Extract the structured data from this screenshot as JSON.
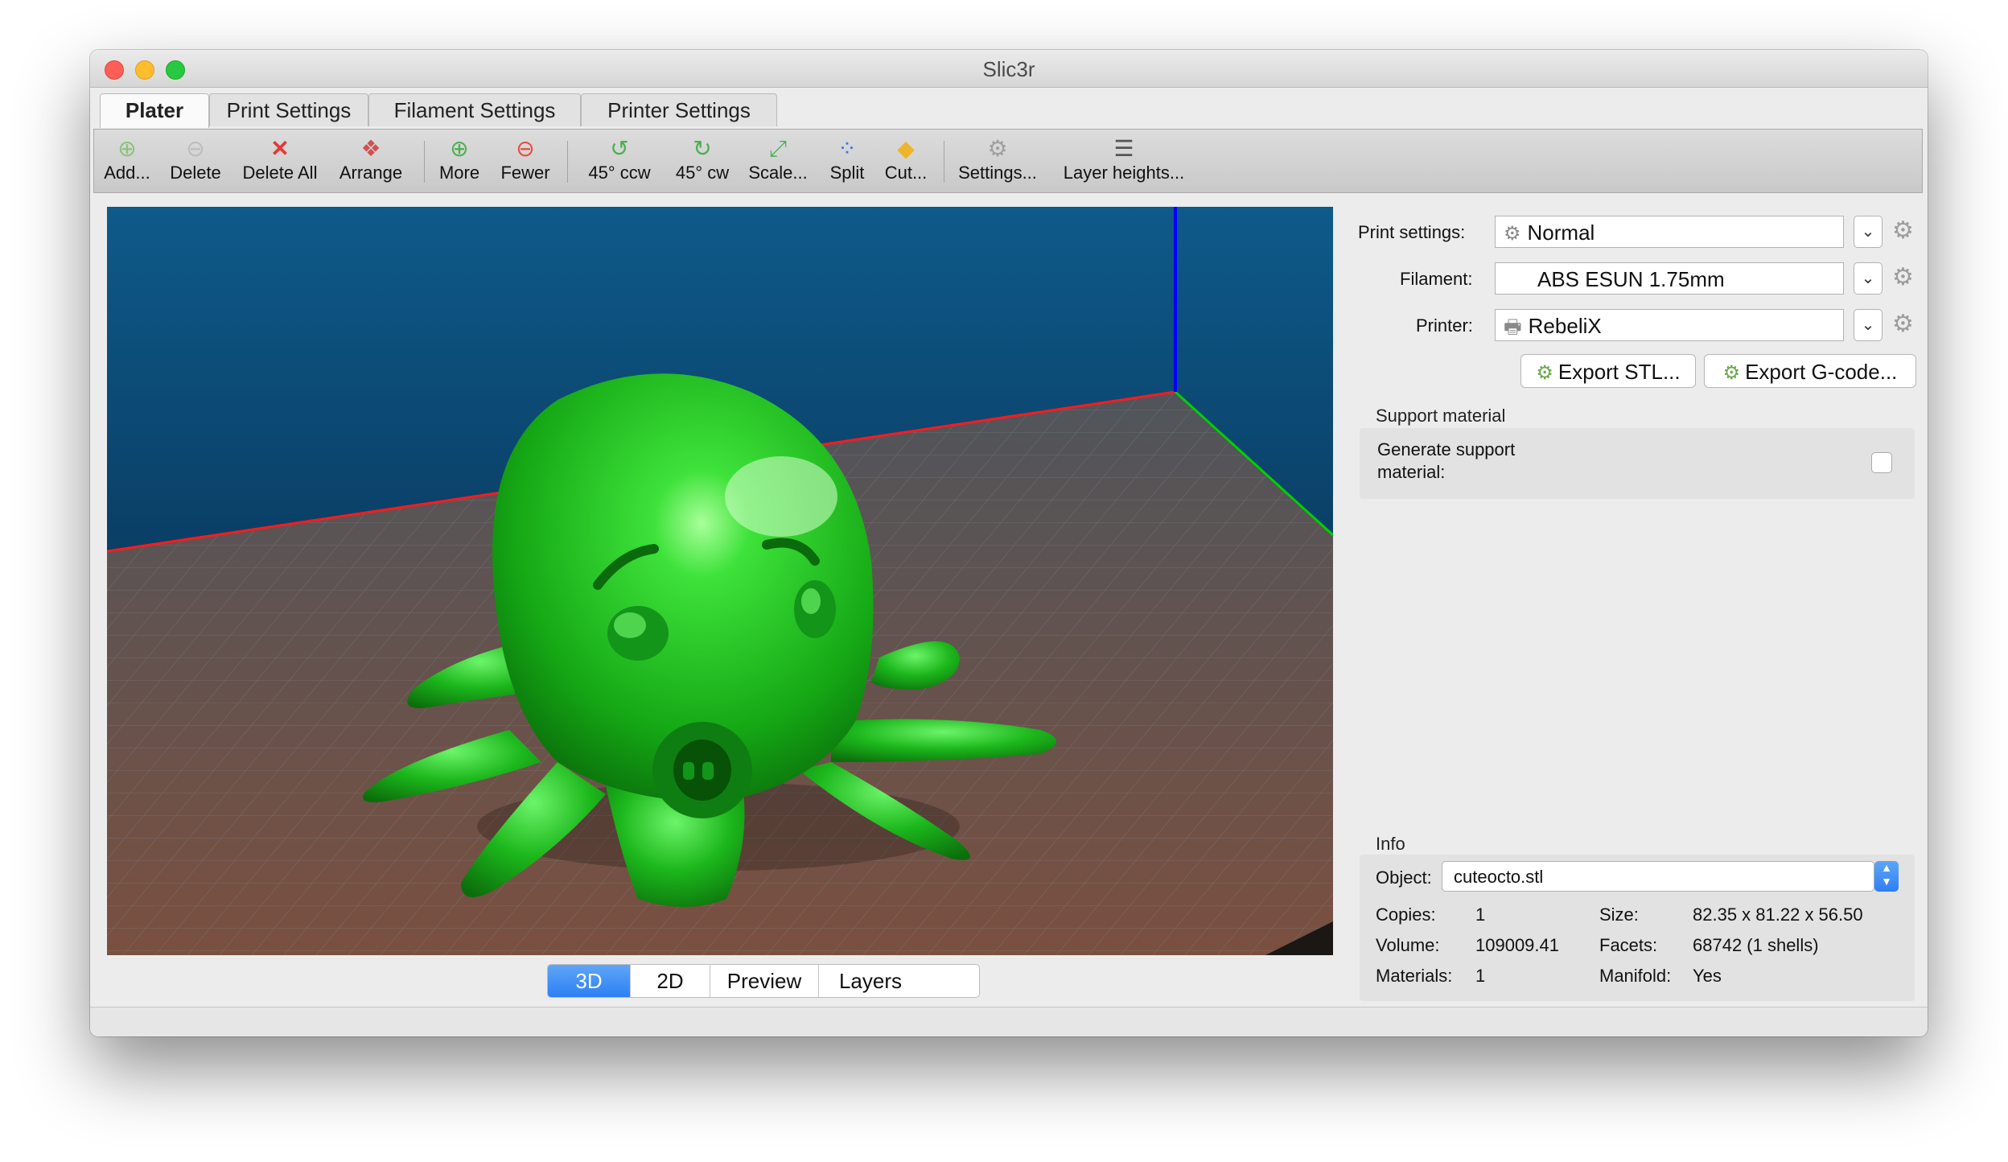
{
  "window": {
    "title": "Slic3r"
  },
  "tabs": [
    "Plater",
    "Print Settings",
    "Filament Settings",
    "Printer Settings"
  ],
  "toolbar": {
    "add": "Add...",
    "delete": "Delete",
    "delete_all": "Delete All",
    "arrange": "Arrange",
    "more": "More",
    "fewer": "Fewer",
    "rotate_ccw": "45° ccw",
    "rotate_cw": "45° cw",
    "scale": "Scale...",
    "split": "Split",
    "cut": "Cut...",
    "settings": "Settings...",
    "layer_heights": "Layer heights..."
  },
  "view_tabs": [
    "3D",
    "2D",
    "Preview",
    "Layers"
  ],
  "view_tabs_active": "3D",
  "presets": {
    "print_label": "Print settings:",
    "print_value": "Normal",
    "filament_label": "Filament:",
    "filament_value": "ABS ESUN 1.75mm",
    "printer_label": "Printer:",
    "printer_value": "RebeliX"
  },
  "export": {
    "stl": "Export STL...",
    "gcode": "Export G-code..."
  },
  "support": {
    "section": "Support material",
    "label_line1": "Generate support",
    "label_line2": "material:",
    "checked": false
  },
  "info": {
    "section": "Info",
    "object_label": "Object:",
    "object_value": "cuteocto.stl",
    "copies_label": "Copies:",
    "copies_value": "1",
    "size_label": "Size:",
    "size_value": "82.35 x 81.22 x 56.50",
    "volume_label": "Volume:",
    "volume_value": "109009.41",
    "facets_label": "Facets:",
    "facets_value": "68742 (1 shells)",
    "materials_label": "Materials:",
    "materials_value": "1",
    "manifold_label": "Manifold:",
    "manifold_value": "Yes"
  },
  "colors": {
    "model": "#1fc21f",
    "bed": "#5e6266",
    "x_axis": "#ff0000",
    "y_axis": "#00cc00",
    "z_axis": "#0000ff",
    "active_tab": "#2d7ff3"
  }
}
